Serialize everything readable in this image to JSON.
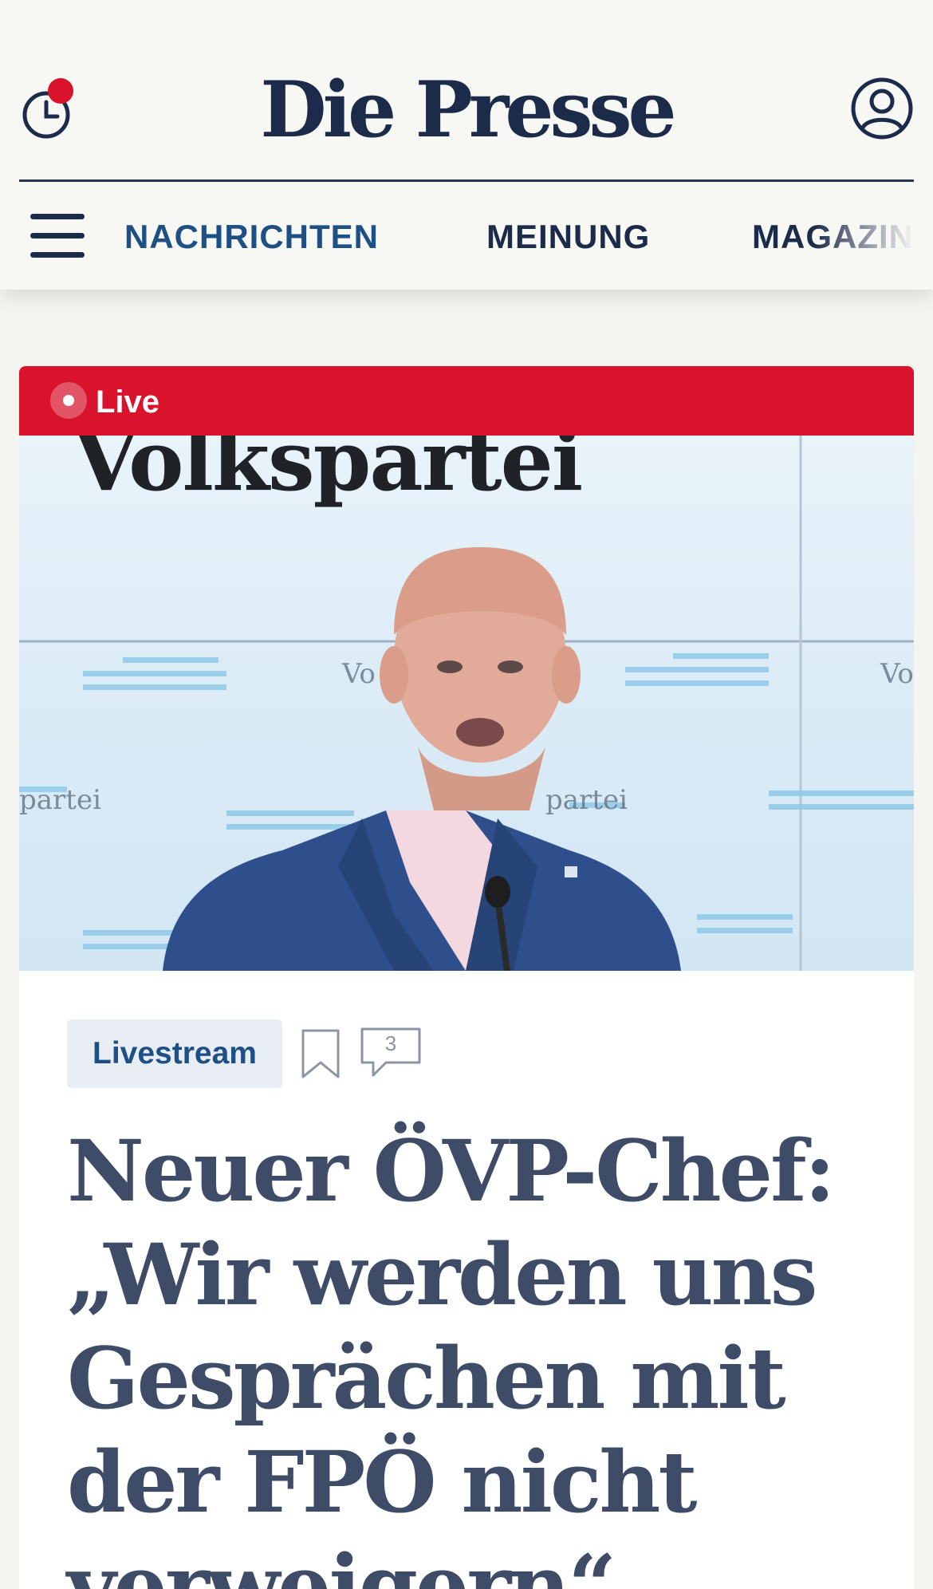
{
  "header": {
    "logo": "Die Presse",
    "history_icon": "history-clock-icon",
    "account_icon": "user-account-icon",
    "notification_color": "#d8132b"
  },
  "nav": {
    "menu_icon": "hamburger-menu-icon",
    "items": [
      {
        "label": "NACHRICHTEN",
        "active": true
      },
      {
        "label": "MEINUNG",
        "active": false
      },
      {
        "label": "MAGAZIN",
        "active": false
      }
    ]
  },
  "article": {
    "live_label": "Live",
    "live_color": "#d8132b",
    "image_text": "Volkspartei",
    "tag": "Livestream",
    "bookmark_icon": "bookmark-icon",
    "comment_icon": "comment-icon",
    "comment_count": "3",
    "headline": "Neuer ÖVP-Chef: „Wir werden uns Gesprächen mit der FPÖ nicht verweigern“"
  },
  "colors": {
    "brand": "#1c2b4a",
    "nav_active": "#1e4f85",
    "headline": "#3f4c68"
  }
}
